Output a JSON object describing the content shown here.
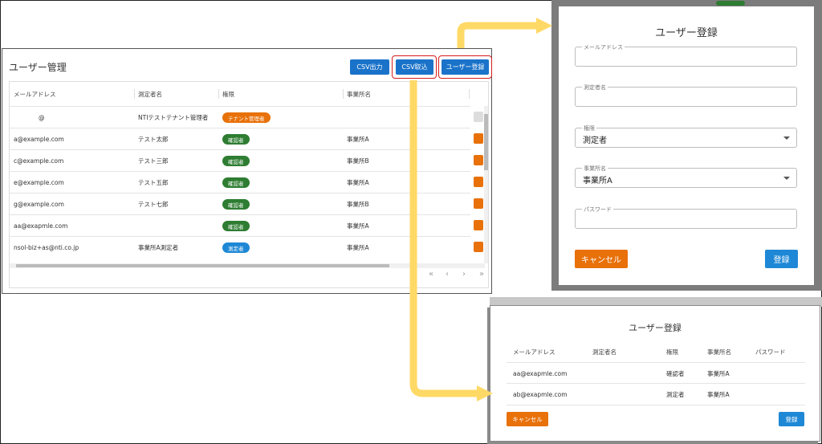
{
  "main": {
    "title": "ユーザー管理",
    "buttons": {
      "csv_export": "CSV出力",
      "csv_import": "CSV取込",
      "user_register": "ユーザー登録"
    },
    "columns": [
      "メールアドレス",
      "測定者名",
      "権限",
      "事業所名"
    ],
    "rows": [
      {
        "email": "@",
        "name": "NTIテストテナント管理者",
        "role": "テナント管理者",
        "role_color": "orange",
        "office": ""
      },
      {
        "email": "a@example.com",
        "name": "テスト太郎",
        "role": "確認者",
        "role_color": "green",
        "office": "事業所A"
      },
      {
        "email": "c@example.com",
        "name": "テスト三郎",
        "role": "確認者",
        "role_color": "green",
        "office": "事業所B"
      },
      {
        "email": "e@example.com",
        "name": "テスト五郎",
        "role": "確認者",
        "role_color": "green",
        "office": "事業所A"
      },
      {
        "email": "g@example.com",
        "name": "テスト七郎",
        "role": "確認者",
        "role_color": "green",
        "office": "事業所B"
      },
      {
        "email": "aa@exapmle.com",
        "name": "",
        "role": "確認者",
        "role_color": "green",
        "office": "事業所A"
      },
      {
        "email": "nsol-biz+as@nti.co.jp",
        "name": "事業所A測定者",
        "role": "測定者",
        "role_color": "blue",
        "office": "事業所A"
      }
    ],
    "pager": [
      "«",
      "‹",
      "›",
      "»"
    ]
  },
  "register_modal": {
    "title": "ユーザー登録",
    "fields": [
      {
        "label": "メールアドレス",
        "value": ""
      },
      {
        "label": "測定者名",
        "value": ""
      },
      {
        "label": "権限",
        "value": "測定者"
      },
      {
        "label": "事業所名",
        "value": "事業所A"
      },
      {
        "label": "パスワード",
        "value": ""
      }
    ],
    "cancel": "キャンセル",
    "submit": "登録"
  },
  "csv_modal": {
    "title": "ユーザー登録",
    "columns": [
      "メールアドレス",
      "測定者名",
      "権限",
      "事業所名",
      "パスワード"
    ],
    "rows": [
      {
        "email": "aa@exapmle.com",
        "name": "",
        "role": "確認者",
        "office": "事業所A",
        "password": ""
      },
      {
        "email": "ab@exapmle.com",
        "name": "",
        "role": "測定者",
        "office": "事業所A",
        "password": ""
      }
    ],
    "cancel": "キャンセル",
    "submit": "登録"
  },
  "colors": {
    "primary": "#1a73c9",
    "orange": "#e8710a",
    "green": "#2e7d32",
    "blue": "#1e88d6",
    "highlight": "#d61c1c",
    "arrow": "#ffd966"
  }
}
